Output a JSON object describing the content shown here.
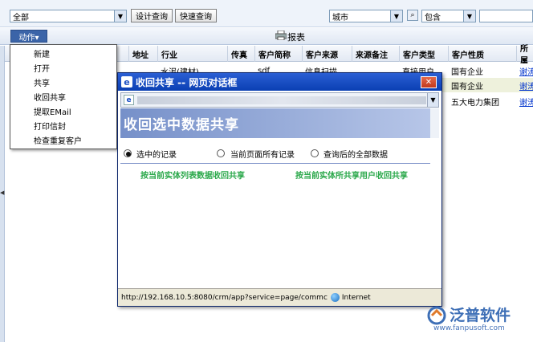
{
  "filter": {
    "scope_value": "全部",
    "design_query_label": "设计查询",
    "quick_query_label": "快速查询",
    "field_value": "城市",
    "operator_value": "包含",
    "value_input": ""
  },
  "toolbar": {
    "action_label": "动作▾",
    "report_label": "报表"
  },
  "table": {
    "headers": [
      "地址",
      "行业",
      "传真",
      "客户简称",
      "客户来源",
      "来源备注",
      "客户类型",
      "客户性质",
      "所属"
    ],
    "rows": [
      [
        "",
        "水泥(建材)",
        "",
        "sdf",
        "信息扫描",
        "",
        "直接用户",
        "国有企业",
        "谢涛"
      ],
      [
        "",
        "",
        "",
        "",
        "",
        "",
        "",
        "国有企业",
        "谢涛"
      ],
      [
        "",
        "",
        "",
        "",
        "",
        "",
        "",
        "五大电力集团",
        "谢涛"
      ]
    ]
  },
  "menu": {
    "items": [
      "新建",
      "打开",
      "共享",
      "收回共享",
      "提取EMail",
      "打印信封",
      "检查重复客户"
    ]
  },
  "dialog": {
    "title": "收回共享 -- 网页对话框",
    "close_label": "✕",
    "heading": "收回选中数据共享",
    "options": [
      "选中的记录",
      "当前页面所有记录",
      "查询后的全部数据"
    ],
    "links": [
      "按当前实体列表数据收回共享",
      "按当前实体所共享用户收回共享"
    ],
    "status_url": "http://192.168.10.5:8080/crm/app?service=page/commc",
    "status_zone": "Internet"
  },
  "watermark": {
    "brand": "泛普软件",
    "url": "www.fanpusoft.com"
  },
  "colors": {
    "title_bar": "#0a3fb3",
    "banner": "#7690c9",
    "link_green": "#2aa84a",
    "link_blue": "#0033cc"
  }
}
